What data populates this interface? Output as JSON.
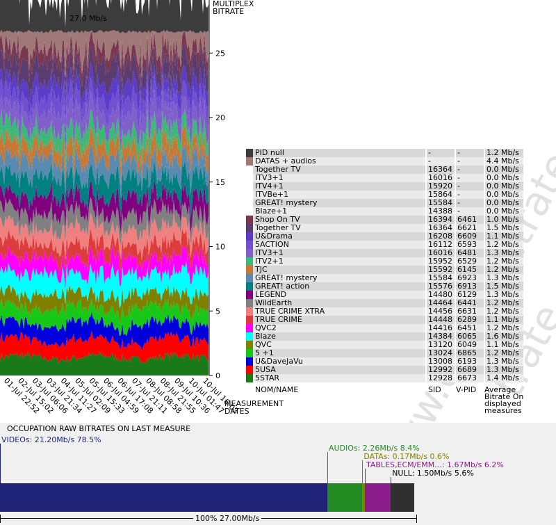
{
  "watermark": "www.digitalbitrate.com",
  "chart_data": {
    "type": "area",
    "title": "27.0 Mb/s",
    "ylabel": "MULTIPLEX BITRATE",
    "xlabel": "MEASUREMENT DATES",
    "ylim": [
      0,
      27
    ],
    "yticks": [
      0,
      5,
      10,
      15,
      20,
      25
    ],
    "x": [
      "01-Jul 22:52",
      "02-Jul 15:02",
      "03-Jul 06:06",
      "03-Jul 21:34",
      "04-Jul 11:27",
      "05-Jul 02:09",
      "05-Jul 15:33",
      "06-Jul 04:59",
      "06-Jul 17:08",
      "07-Jul 21:11",
      "08-Jul 08:58",
      "08-Jul 21:55",
      "09-Jul 10:36",
      "10-Jul 01:47",
      "10-Jul 16:03"
    ],
    "series": [
      {
        "name": "5STAR",
        "color": "#1a7a1a",
        "value": 1.4
      },
      {
        "name": "5USA",
        "color": "#ff0000",
        "value": 1.3
      },
      {
        "name": "U&DaveJaVu",
        "color": "#0000dd",
        "value": 1.3
      },
      {
        "name": "5 +1",
        "color": "#18c818",
        "value": 1.2
      },
      {
        "name": "QVC",
        "color": "#808000",
        "value": 1.1
      },
      {
        "name": "Blaze",
        "color": "#00ffff",
        "value": 1.6
      },
      {
        "name": "QVC2",
        "color": "#ff00ff",
        "value": 1.2
      },
      {
        "name": "TRUE CRIME",
        "color": "#dd3c3c",
        "value": 1.1
      },
      {
        "name": "TRUE CRIME XTRA",
        "color": "#f08080",
        "value": 1.2
      },
      {
        "name": "WildEarth",
        "color": "#808080",
        "value": 1.2
      },
      {
        "name": "LEGEND",
        "color": "#800080",
        "value": 1.3
      },
      {
        "name": "GREAT! action",
        "color": "#008080",
        "value": 1.5
      },
      {
        "name": "GREAT! mystery",
        "color": "#5a8ab0",
        "value": 1.3
      },
      {
        "name": "TJC",
        "color": "#c87832",
        "value": 1.2
      },
      {
        "name": "ITV2+1",
        "color": "#3cb878",
        "value": 1.2
      },
      {
        "name": "ITV3+1",
        "color": "#8060c8",
        "value": 1.3
      },
      {
        "name": "5ACTION",
        "color": "#7050d0",
        "value": 1.2
      },
      {
        "name": "U&Drama",
        "color": "#5a3cc8",
        "value": 1.1
      },
      {
        "name": "Together TV",
        "color": "#5a3c70",
        "value": 1.5
      },
      {
        "name": "Shop On TV",
        "color": "#7a3850",
        "value": 1.0
      },
      {
        "name": "DATAS + audios",
        "color": "#a07878",
        "value": 4.4
      },
      {
        "name": "PID null",
        "color": "#3c3c3c",
        "value": 1.2
      }
    ]
  },
  "legend": {
    "headers": {
      "name": "NOM/NAME",
      "sid": "SID",
      "vpid": "V-PID",
      "bitrate": "Average Bitrate On displayed measures"
    },
    "rows": [
      {
        "color": "#3c3c3c",
        "name": "PID null",
        "sid": "-",
        "vpid": "-",
        "bitrate": "1.2 Mb/s"
      },
      {
        "color": "#a07878",
        "name": "DATAS + audios",
        "sid": "-",
        "vpid": "-",
        "bitrate": "4.4 Mb/s"
      },
      {
        "color": "",
        "name": "Together TV",
        "sid": "16364",
        "vpid": "-",
        "bitrate": "0.0 Mb/s"
      },
      {
        "color": "",
        "name": "ITV3+1",
        "sid": "16016",
        "vpid": "-",
        "bitrate": "0.0 Mb/s"
      },
      {
        "color": "",
        "name": "ITV4+1",
        "sid": "15920",
        "vpid": "-",
        "bitrate": "0.0 Mb/s"
      },
      {
        "color": "",
        "name": "ITVBe+1",
        "sid": "15864",
        "vpid": "-",
        "bitrate": "0.0 Mb/s"
      },
      {
        "color": "",
        "name": "GREAT! mystery",
        "sid": "15584",
        "vpid": "-",
        "bitrate": "0.0 Mb/s"
      },
      {
        "color": "",
        "name": "Blaze+1",
        "sid": "14388",
        "vpid": "-",
        "bitrate": "0.0 Mb/s"
      },
      {
        "color": "#7a3850",
        "name": "Shop On TV",
        "sid": "16394",
        "vpid": "6461",
        "bitrate": "1.0 Mb/s"
      },
      {
        "color": "#5a3c70",
        "name": "Together TV",
        "sid": "16364",
        "vpid": "6621",
        "bitrate": "1.5 Mb/s"
      },
      {
        "color": "#5a3cc8",
        "name": "U&Drama",
        "sid": "16208",
        "vpid": "6609",
        "bitrate": "1.1 Mb/s"
      },
      {
        "color": "#7050d0",
        "name": "5ACTION",
        "sid": "16112",
        "vpid": "6593",
        "bitrate": "1.2 Mb/s"
      },
      {
        "color": "#8060c8",
        "name": "ITV3+1",
        "sid": "16016",
        "vpid": "6481",
        "bitrate": "1.3 Mb/s"
      },
      {
        "color": "#3cb878",
        "name": "ITV2+1",
        "sid": "15952",
        "vpid": "6529",
        "bitrate": "1.2 Mb/s"
      },
      {
        "color": "#c87832",
        "name": "TJC",
        "sid": "15592",
        "vpid": "6145",
        "bitrate": "1.2 Mb/s"
      },
      {
        "color": "#5a8ab0",
        "name": "GREAT! mystery",
        "sid": "15584",
        "vpid": "6923",
        "bitrate": "1.3 Mb/s"
      },
      {
        "color": "#008080",
        "name": "GREAT! action",
        "sid": "15576",
        "vpid": "6913",
        "bitrate": "1.5 Mb/s"
      },
      {
        "color": "#800080",
        "name": "LEGEND",
        "sid": "14480",
        "vpid": "6129",
        "bitrate": "1.3 Mb/s"
      },
      {
        "color": "#808080",
        "name": "WildEarth",
        "sid": "14464",
        "vpid": "6441",
        "bitrate": "1.2 Mb/s"
      },
      {
        "color": "#f08080",
        "name": "TRUE CRIME XTRA",
        "sid": "14456",
        "vpid": "6631",
        "bitrate": "1.2 Mb/s"
      },
      {
        "color": "#dd3c3c",
        "name": "TRUE CRIME",
        "sid": "14448",
        "vpid": "6289",
        "bitrate": "1.1 Mb/s"
      },
      {
        "color": "#ff00ff",
        "name": "QVC2",
        "sid": "14416",
        "vpid": "6451",
        "bitrate": "1.2 Mb/s"
      },
      {
        "color": "#00ffff",
        "name": "Blaze",
        "sid": "14384",
        "vpid": "6065",
        "bitrate": "1.6 Mb/s"
      },
      {
        "color": "#808000",
        "name": "QVC",
        "sid": "13120",
        "vpid": "6049",
        "bitrate": "1.1 Mb/s"
      },
      {
        "color": "#18c818",
        "name": "5 +1",
        "sid": "13024",
        "vpid": "6865",
        "bitrate": "1.2 Mb/s"
      },
      {
        "color": "#0000dd",
        "name": "U&DaveJaVu",
        "sid": "13008",
        "vpid": "6193",
        "bitrate": "1.3 Mb/s"
      },
      {
        "color": "#ff0000",
        "name": "5USA",
        "sid": "12992",
        "vpid": "6689",
        "bitrate": "1.3 Mb/s"
      },
      {
        "color": "#1a7a1a",
        "name": "5STAR",
        "sid": "12928",
        "vpid": "6673",
        "bitrate": "1.4 Mb/s"
      }
    ]
  },
  "occupation": {
    "title": "OCCUPATION RAW BITRATES ON LAST MEASURE",
    "total_label": "100%  27.00Mb/s",
    "segments": [
      {
        "label": "VIDEOs: 21.20Mb/s  78.5%",
        "percent": 78.5,
        "color": "#1e2378",
        "text_color": "#1e2378"
      },
      {
        "label": "AUDIOs: 2.26Mb/s  8.4%",
        "percent": 8.4,
        "color": "#228b22",
        "text_color": "#228b22"
      },
      {
        "label": "DATAs: 0.17Mb/s  0.6%",
        "percent": 0.6,
        "color": "#808000",
        "text_color": "#808000"
      },
      {
        "label": "TABLES,ECM/EMM...: 1.67Mb/s  6.2%",
        "percent": 6.2,
        "color": "#8b1a8b",
        "text_color": "#8b1a8b"
      },
      {
        "label": "NULL: 1.50Mb/s  5.6%",
        "percent": 5.6,
        "color": "#303030",
        "text_color": "#000000"
      }
    ]
  }
}
